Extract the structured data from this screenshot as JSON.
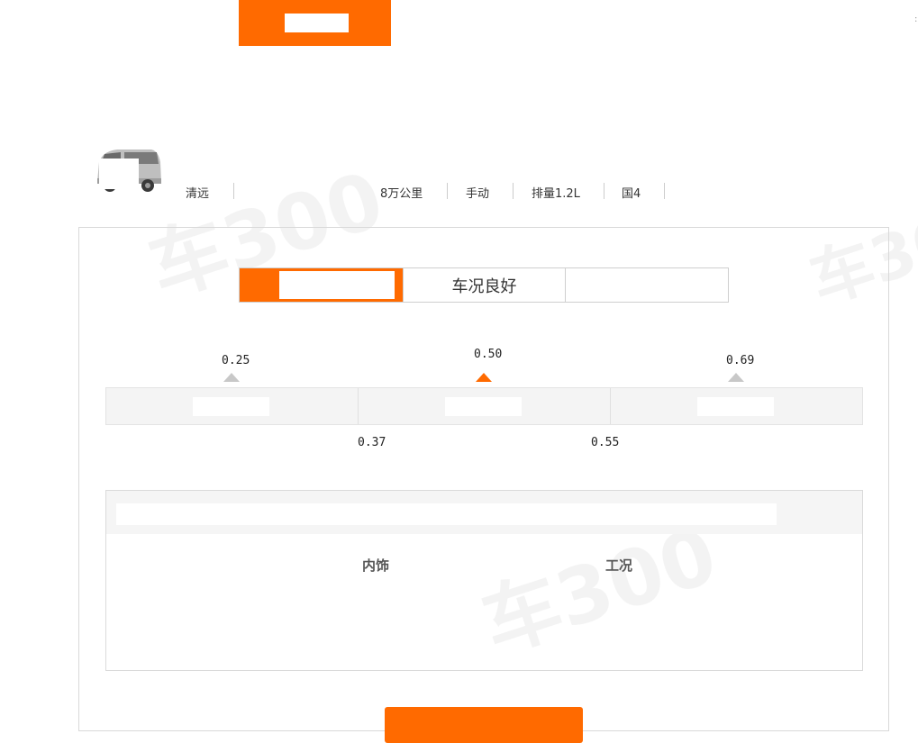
{
  "header": {
    "button_label": ""
  },
  "specs": {
    "city": "清远",
    "mileage": "8万公里",
    "transmission": "手动",
    "displacement": "排量1.2L",
    "emission": "国4"
  },
  "tabs": [
    {
      "label": ""
    },
    {
      "label": "车况良好"
    },
    {
      "label": ""
    }
  ],
  "price_scale": {
    "markers": [
      "0.25",
      "0.50",
      "0.69"
    ],
    "boundaries": [
      "0.37",
      "0.55"
    ],
    "active_marker_index": 1
  },
  "detail": {
    "labels": [
      "内饰",
      "工况"
    ]
  },
  "watermark": "车300",
  "colors": {
    "accent": "#ff6a00",
    "marker_inactive": "#c8c8c8",
    "bar_bg": "#f4f4f4"
  }
}
